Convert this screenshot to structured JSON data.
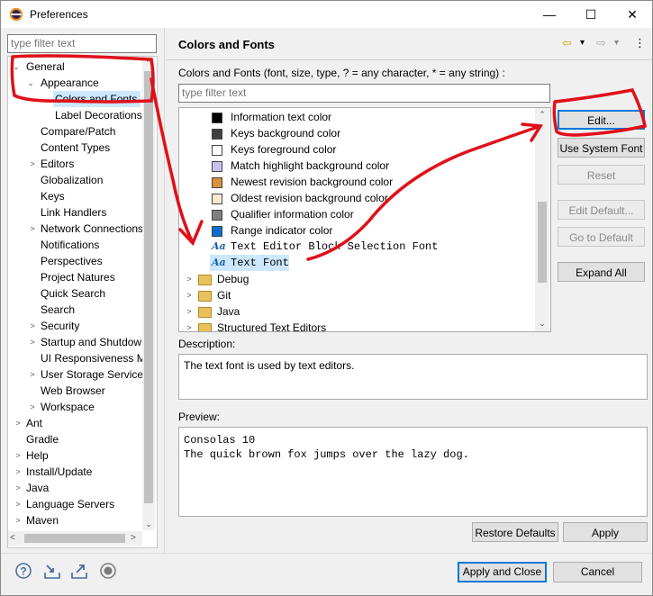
{
  "window": {
    "title": "Preferences",
    "minimize": "—",
    "maximize": "☐",
    "close": "✕"
  },
  "filter": {
    "placeholder": "type filter text"
  },
  "tree": {
    "items": [
      {
        "label": "General",
        "twisty": "v"
      },
      {
        "label": "Appearance",
        "twisty": "v"
      },
      {
        "label": "Colors and Fonts",
        "twisty": ""
      },
      {
        "label": "Label Decorations",
        "twisty": ""
      },
      {
        "label": "Compare/Patch",
        "twisty": ""
      },
      {
        "label": "Content Types",
        "twisty": ""
      },
      {
        "label": "Editors",
        "twisty": ">"
      },
      {
        "label": "Globalization",
        "twisty": ""
      },
      {
        "label": "Keys",
        "twisty": ""
      },
      {
        "label": "Link Handlers",
        "twisty": ""
      },
      {
        "label": "Network Connections",
        "twisty": ">"
      },
      {
        "label": "Notifications",
        "twisty": ""
      },
      {
        "label": "Perspectives",
        "twisty": ""
      },
      {
        "label": "Project Natures",
        "twisty": ""
      },
      {
        "label": "Quick Search",
        "twisty": ""
      },
      {
        "label": "Search",
        "twisty": ""
      },
      {
        "label": "Security",
        "twisty": ">"
      },
      {
        "label": "Startup and Shutdown",
        "twisty": ">"
      },
      {
        "label": "UI Responsiveness M",
        "twisty": ""
      },
      {
        "label": "User Storage Service",
        "twisty": ">"
      },
      {
        "label": "Web Browser",
        "twisty": ""
      },
      {
        "label": "Workspace",
        "twisty": ">"
      },
      {
        "label": "Ant",
        "twisty": ">"
      },
      {
        "label": "Gradle",
        "twisty": ""
      },
      {
        "label": "Help",
        "twisty": ">"
      },
      {
        "label": "Install/Update",
        "twisty": ">"
      },
      {
        "label": "Java",
        "twisty": ">"
      },
      {
        "label": "Language Servers",
        "twisty": ">"
      },
      {
        "label": "Maven",
        "twisty": ">"
      }
    ]
  },
  "page": {
    "title": "Colors and Fonts",
    "nav": {
      "back": "⇦",
      "back_menu": "▾",
      "forward": "⇨",
      "forward_menu": "▾",
      "menu": "⋮"
    },
    "list_label": "Colors and Fonts (font, size, type, ? = any character, * = any string) :",
    "list_filter_placeholder": "type filter text",
    "color_items": [
      {
        "label": "Information text color",
        "color": "#000000"
      },
      {
        "label": "Keys background color",
        "color": "#404040"
      },
      {
        "label": "Keys foreground color",
        "color": "#ffffff"
      },
      {
        "label": "Match highlight background color",
        "color": "#c8c0f0"
      },
      {
        "label": "Newest revision background color",
        "color": "#d9903a"
      },
      {
        "label": "Oldest revision background color",
        "color": "#fbe6d2"
      },
      {
        "label": "Qualifier information color",
        "color": "#808080"
      },
      {
        "label": "Range indicator color",
        "color": "#0a6ed1"
      }
    ],
    "font_items": [
      {
        "label": "Text Editor Block Selection Font",
        "icon": "Aa"
      },
      {
        "label": "Text Font",
        "icon": "Aa"
      }
    ],
    "categories": [
      "Debug",
      "Git",
      "Java",
      "Structured Text Editors"
    ],
    "buttons": {
      "edit": "Edit...",
      "use_system_font": "Use System Font",
      "reset": "Reset",
      "edit_default": "Edit Default...",
      "go_to_default": "Go to Default",
      "expand_all": "Expand All"
    },
    "description_label": "Description:",
    "description_text": "The text font is used by text editors.",
    "preview_label": "Preview:",
    "preview_lines": [
      "Consolas 10",
      "The quick brown fox jumps over the lazy dog."
    ],
    "restore_defaults": "Restore Defaults",
    "apply": "Apply"
  },
  "footer": {
    "apply_and_close": "Apply and Close",
    "cancel": "Cancel",
    "icons": [
      "help-icon",
      "import-icon",
      "export-icon",
      "record-icon"
    ]
  },
  "annotation_color": "#e0101a"
}
